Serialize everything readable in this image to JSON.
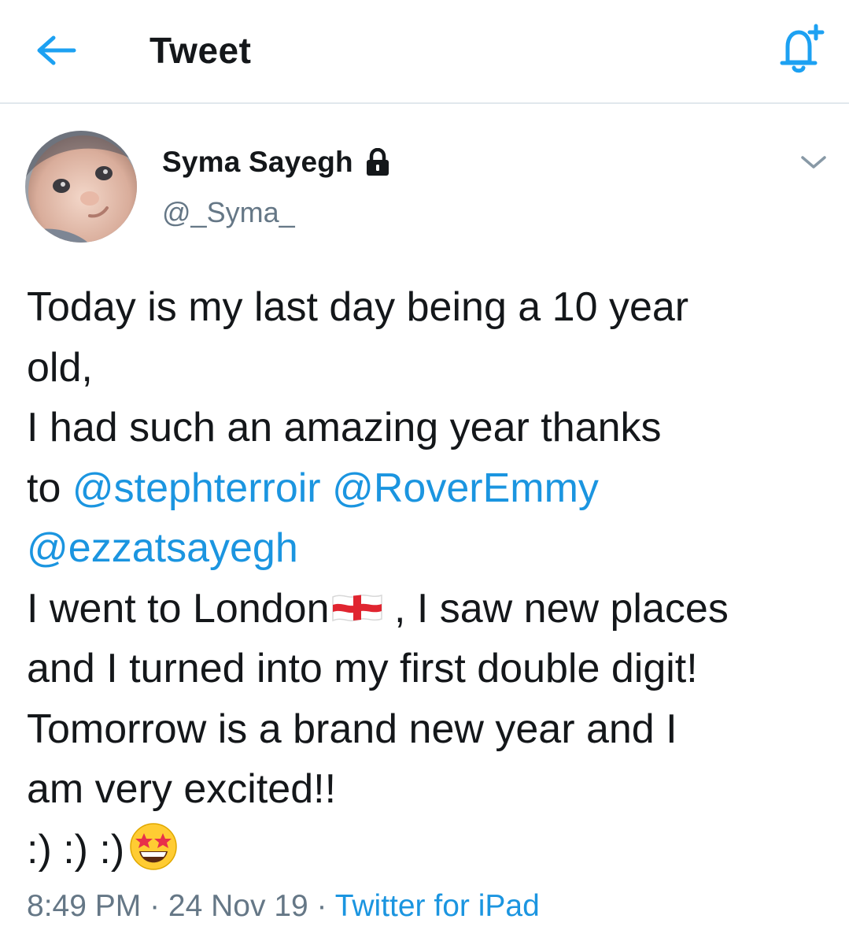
{
  "header": {
    "title": "Tweet",
    "back_icon": "arrow-left-icon",
    "bell_icon": "bell-plus-icon",
    "accent_color": "#1da1f2"
  },
  "tweet": {
    "author": {
      "display_name": "Syma Sayegh",
      "handle": "@_Syma_",
      "protected_icon": "lock-icon",
      "avatar": "avatar-photo"
    },
    "lines": {
      "l1": "Today is my last day being a 10 year",
      "l2": "old,",
      "l3": "I had such an amazing year thanks",
      "l4_prefix": "to ",
      "mention_1": "@stephterroir",
      "mention_2": "@RoverEmmy",
      "mention_3": "@ezzatsayegh",
      "l6_a": "I went to London",
      "l6_b": " , I saw new places",
      "l7": "and I turned into my first double digit!",
      "l8": "Tomorrow is a brand new year and I",
      "l9": "am very excited!!",
      "l10": ":) :) :)"
    },
    "emojis": {
      "flag": "england-flag-icon",
      "face": "star-struck-emoji-icon"
    },
    "meta": {
      "time": "8:49 PM",
      "separator": " · ",
      "date": "24 Nov 19",
      "source": "Twitter for iPad"
    },
    "mention_color": "#1b95e0"
  }
}
